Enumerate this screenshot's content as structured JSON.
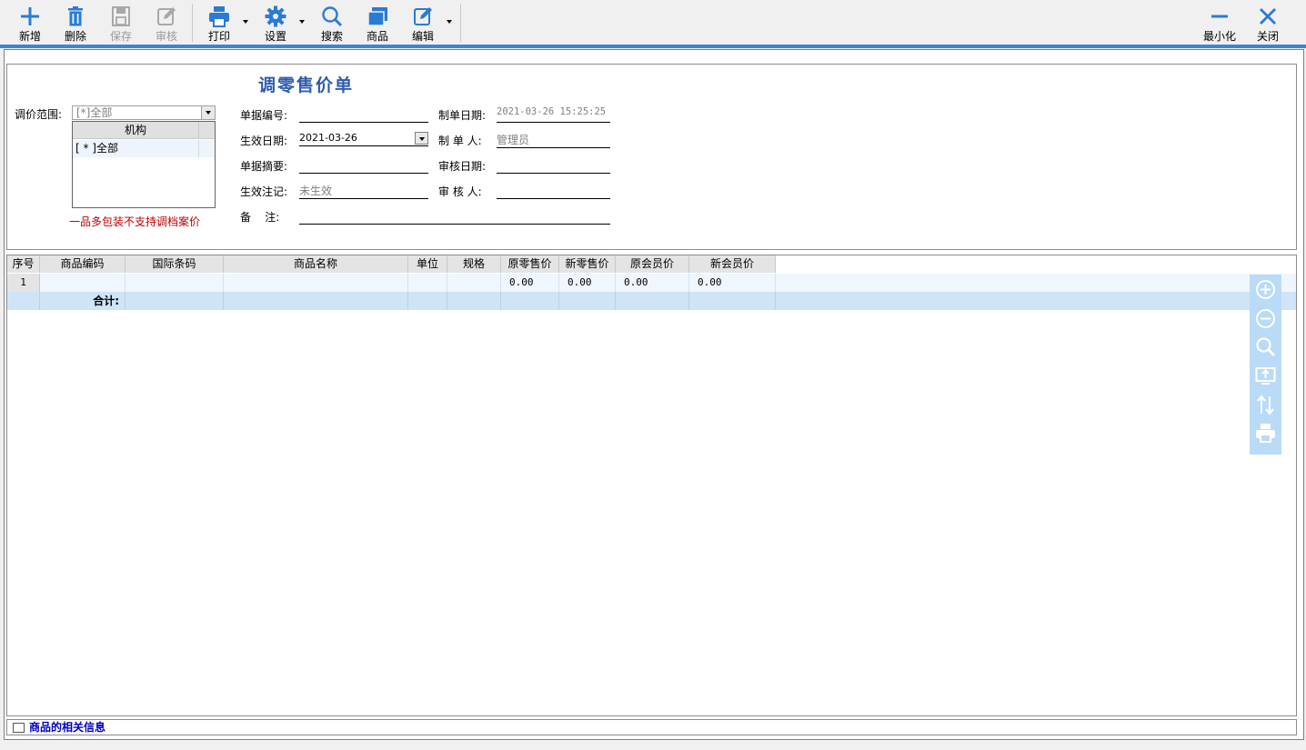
{
  "toolbar": {
    "add": "新增",
    "delete": "删除",
    "save": "保存",
    "audit": "审核",
    "print": "打印",
    "settings": "设置",
    "search": "搜索",
    "goods": "商品",
    "edit": "编辑",
    "minimize": "最小化",
    "close": "关闭"
  },
  "form": {
    "title": "调零售价单",
    "scope_label": "调价范围:",
    "scope_value": "[*]全部",
    "dropdown_header": "机构",
    "dropdown_item": "[ * ]全部",
    "warning": "一品多包装不支持调档案价",
    "doc_no_label": "单据编号:",
    "doc_no_value": "",
    "create_date_label": "制单日期:",
    "create_date_value": "2021-03-26 15:25:25",
    "effective_date_label": "生效日期:",
    "effective_date_value": "2021-03-26",
    "creator_label": "制 单 人:",
    "creator_value": "管理员",
    "summary_label": "单据摘要:",
    "summary_value": "",
    "audit_date_label": "审核日期:",
    "audit_date_value": "",
    "effective_flag_label": "生效注记:",
    "effective_flag_value": "未生效",
    "auditor_label": "审 核 人:",
    "auditor_value": "",
    "remark_label": "备    注:",
    "remark_value": ""
  },
  "grid": {
    "headers": [
      "序号",
      "商品编码",
      "国际条码",
      "商品名称",
      "单位",
      "规格",
      "原零售价",
      "新零售价",
      "原会员价",
      "新会员价"
    ],
    "row": {
      "index": "1",
      "old_retail": "0.00",
      "new_retail": "0.00",
      "old_member": "0.00",
      "new_member": "0.00"
    },
    "total_label": "合计:"
  },
  "status": {
    "text": "商品的相关信息"
  }
}
